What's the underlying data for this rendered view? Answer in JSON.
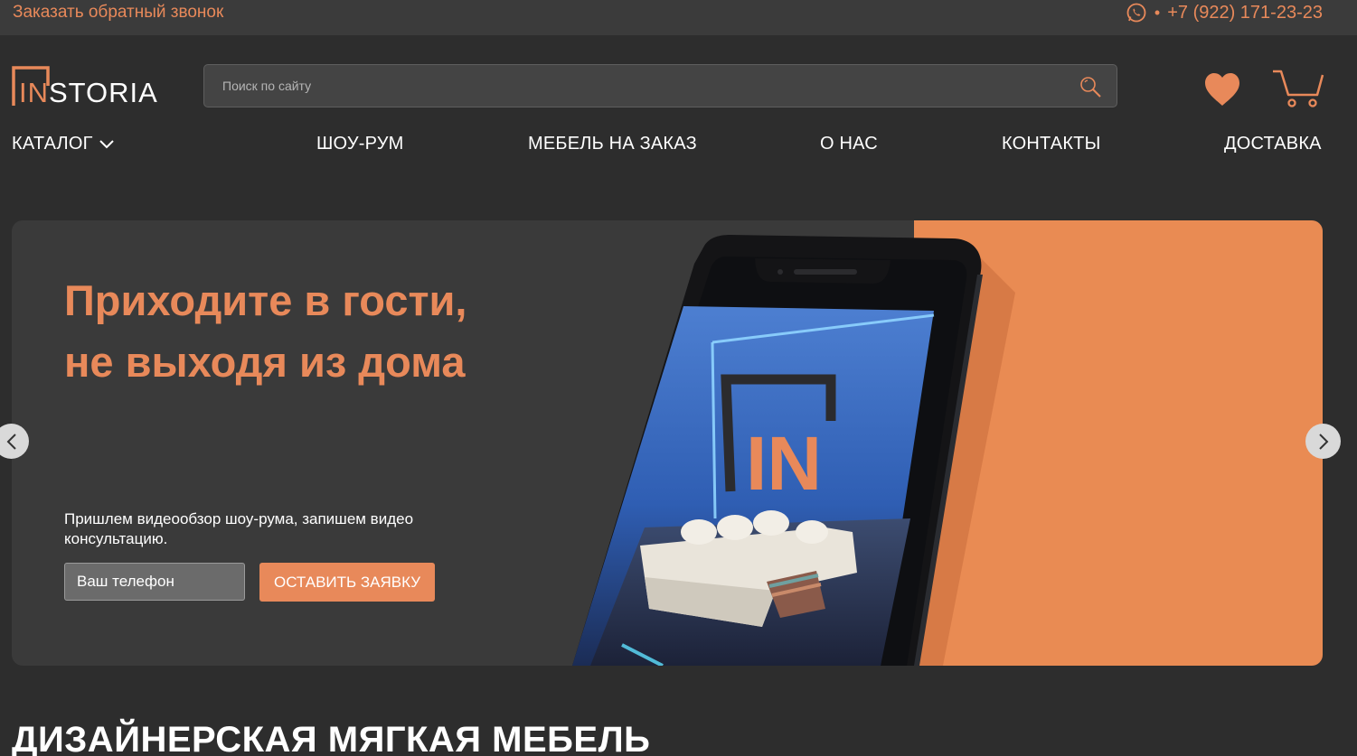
{
  "topbar": {
    "callback_label": "Заказать обратный звонок",
    "separator": "•",
    "phone": "+7 (922) 171-23-23",
    "whatsapp_icon": "whatsapp-icon"
  },
  "header": {
    "logo_text_in": "IN",
    "logo_text_rest": "STORIA",
    "search_placeholder": "Поиск по сайту",
    "search_icon": "search-icon",
    "favorites_icon": "heart-icon",
    "cart_icon": "cart-icon"
  },
  "nav": {
    "items": [
      {
        "label": "КАТАЛОГ"
      },
      {
        "label": "ШОУ-РУМ"
      },
      {
        "label": "МЕБЕЛЬ НА ЗАКАЗ"
      },
      {
        "label": "О НАС"
      },
      {
        "label": "КОНТАКТЫ"
      },
      {
        "label": "ДОСТАВКА"
      }
    ]
  },
  "hero": {
    "title_line1": "Приходите в гости,",
    "title_line2": "не выходя из дома",
    "subtitle": "Пришлем видеообзор шоу-рума, запишем видео консультацию.",
    "phone_placeholder": "Ваш телефон",
    "submit_label": "ОСТАВИТЬ ЗАЯВКУ",
    "screen_logo": "IN"
  },
  "section": {
    "title": "ДИЗАЙНЕРСКАЯ МЯГКАЯ МЕБЕЛЬ"
  },
  "colors": {
    "accent": "#e8895a",
    "background": "#2d2d2d",
    "topbar": "#3b3b3b",
    "hero_bg": "#3a3a3a",
    "hero_orange": "#e98b53"
  }
}
